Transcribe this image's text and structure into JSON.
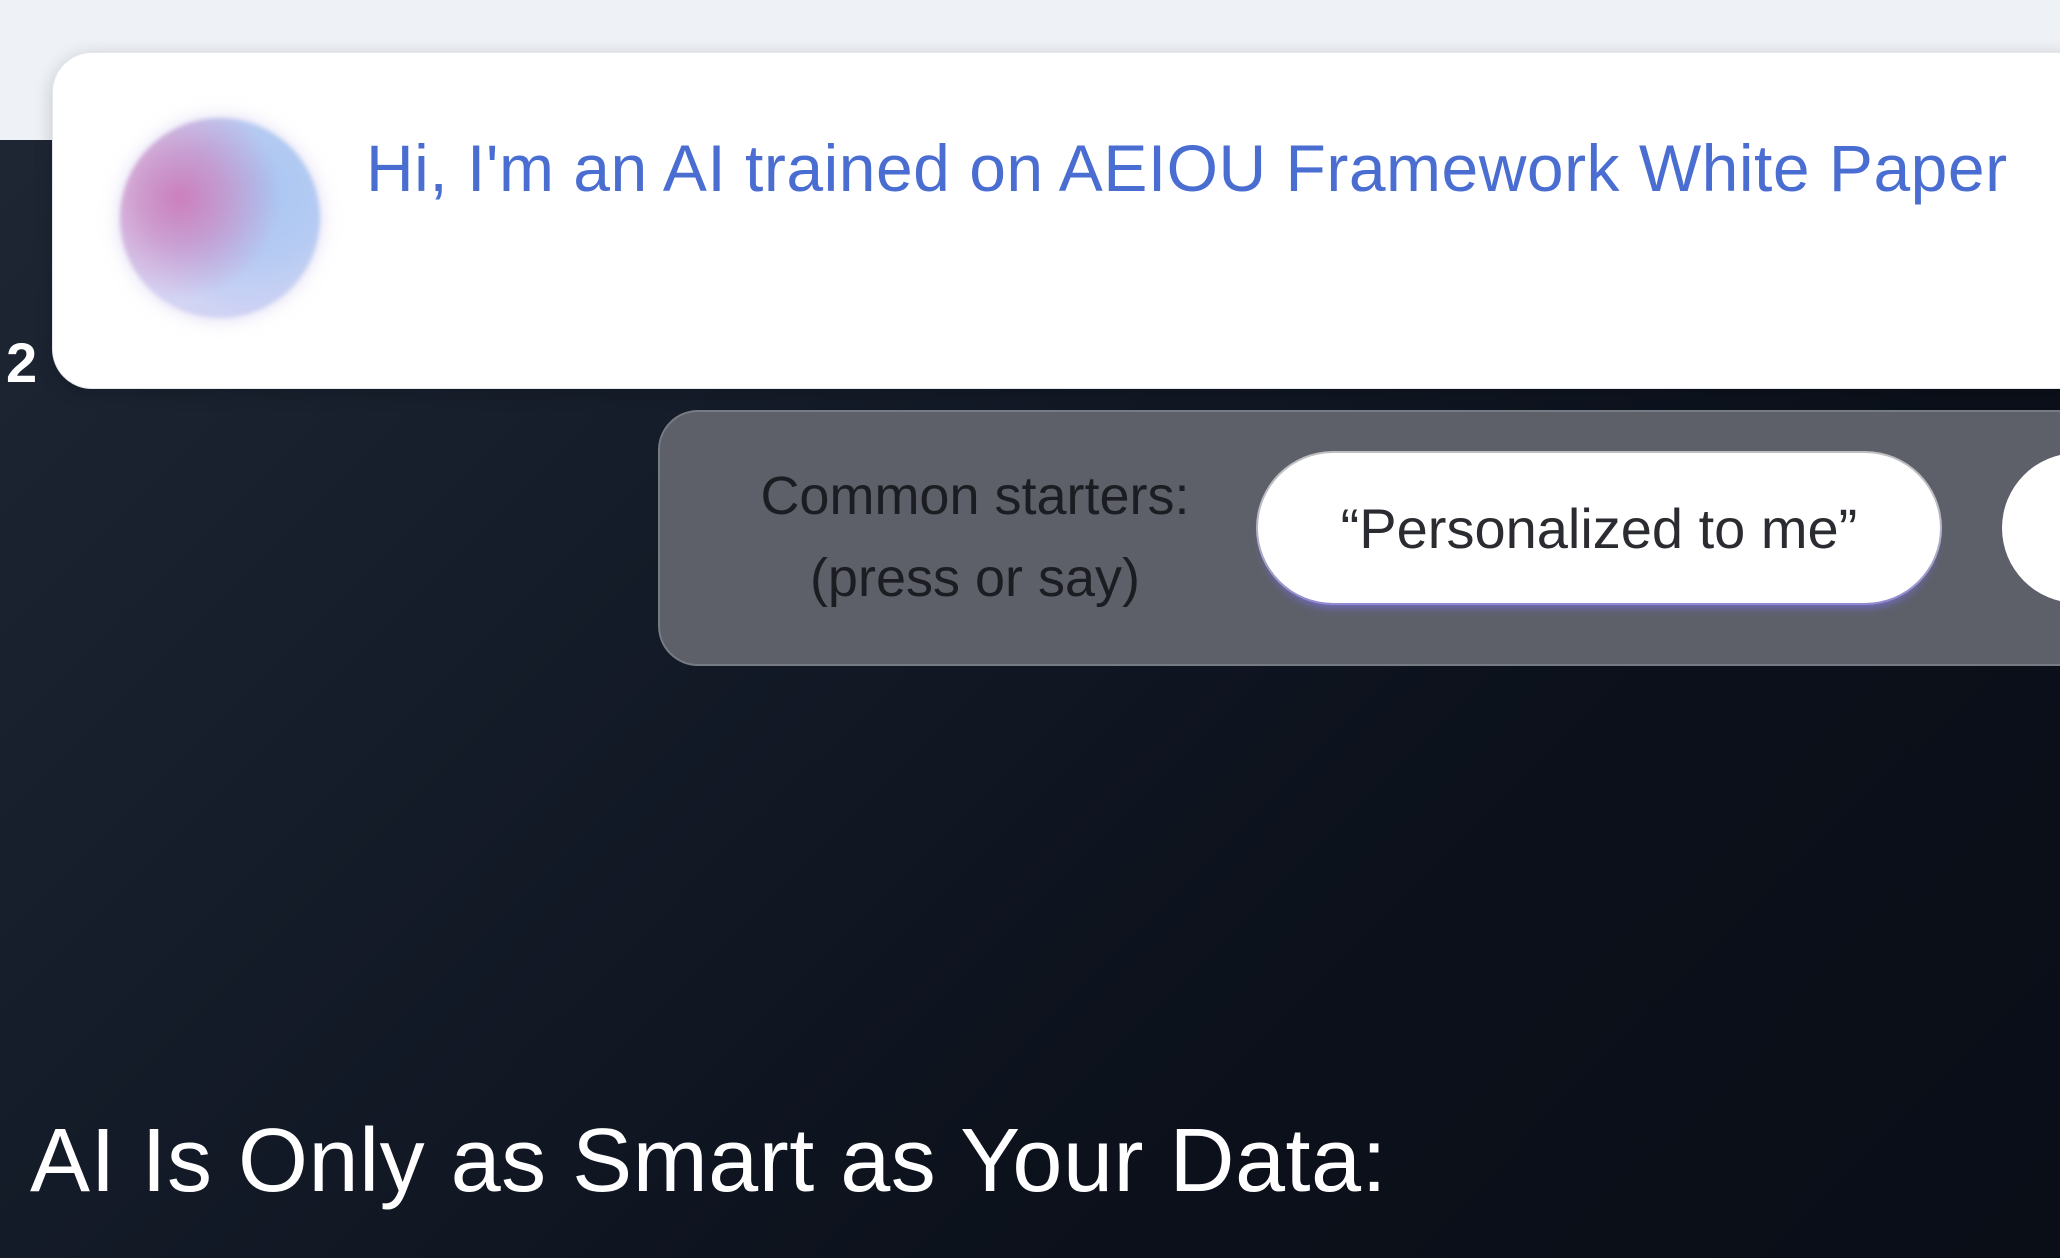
{
  "background_year_fragment": "2",
  "ai_intro": {
    "text": "Hi, I'm an AI trained on AEIOU Framework White Paper",
    "accent_color": "#4a6dd1"
  },
  "starters": {
    "label_line1": "Common starters:",
    "label_line2": "(press or say)",
    "chips": [
      "“Personalized to me”",
      ""
    ]
  },
  "page": {
    "heading": "AI Is Only as Smart as Your Data:"
  }
}
